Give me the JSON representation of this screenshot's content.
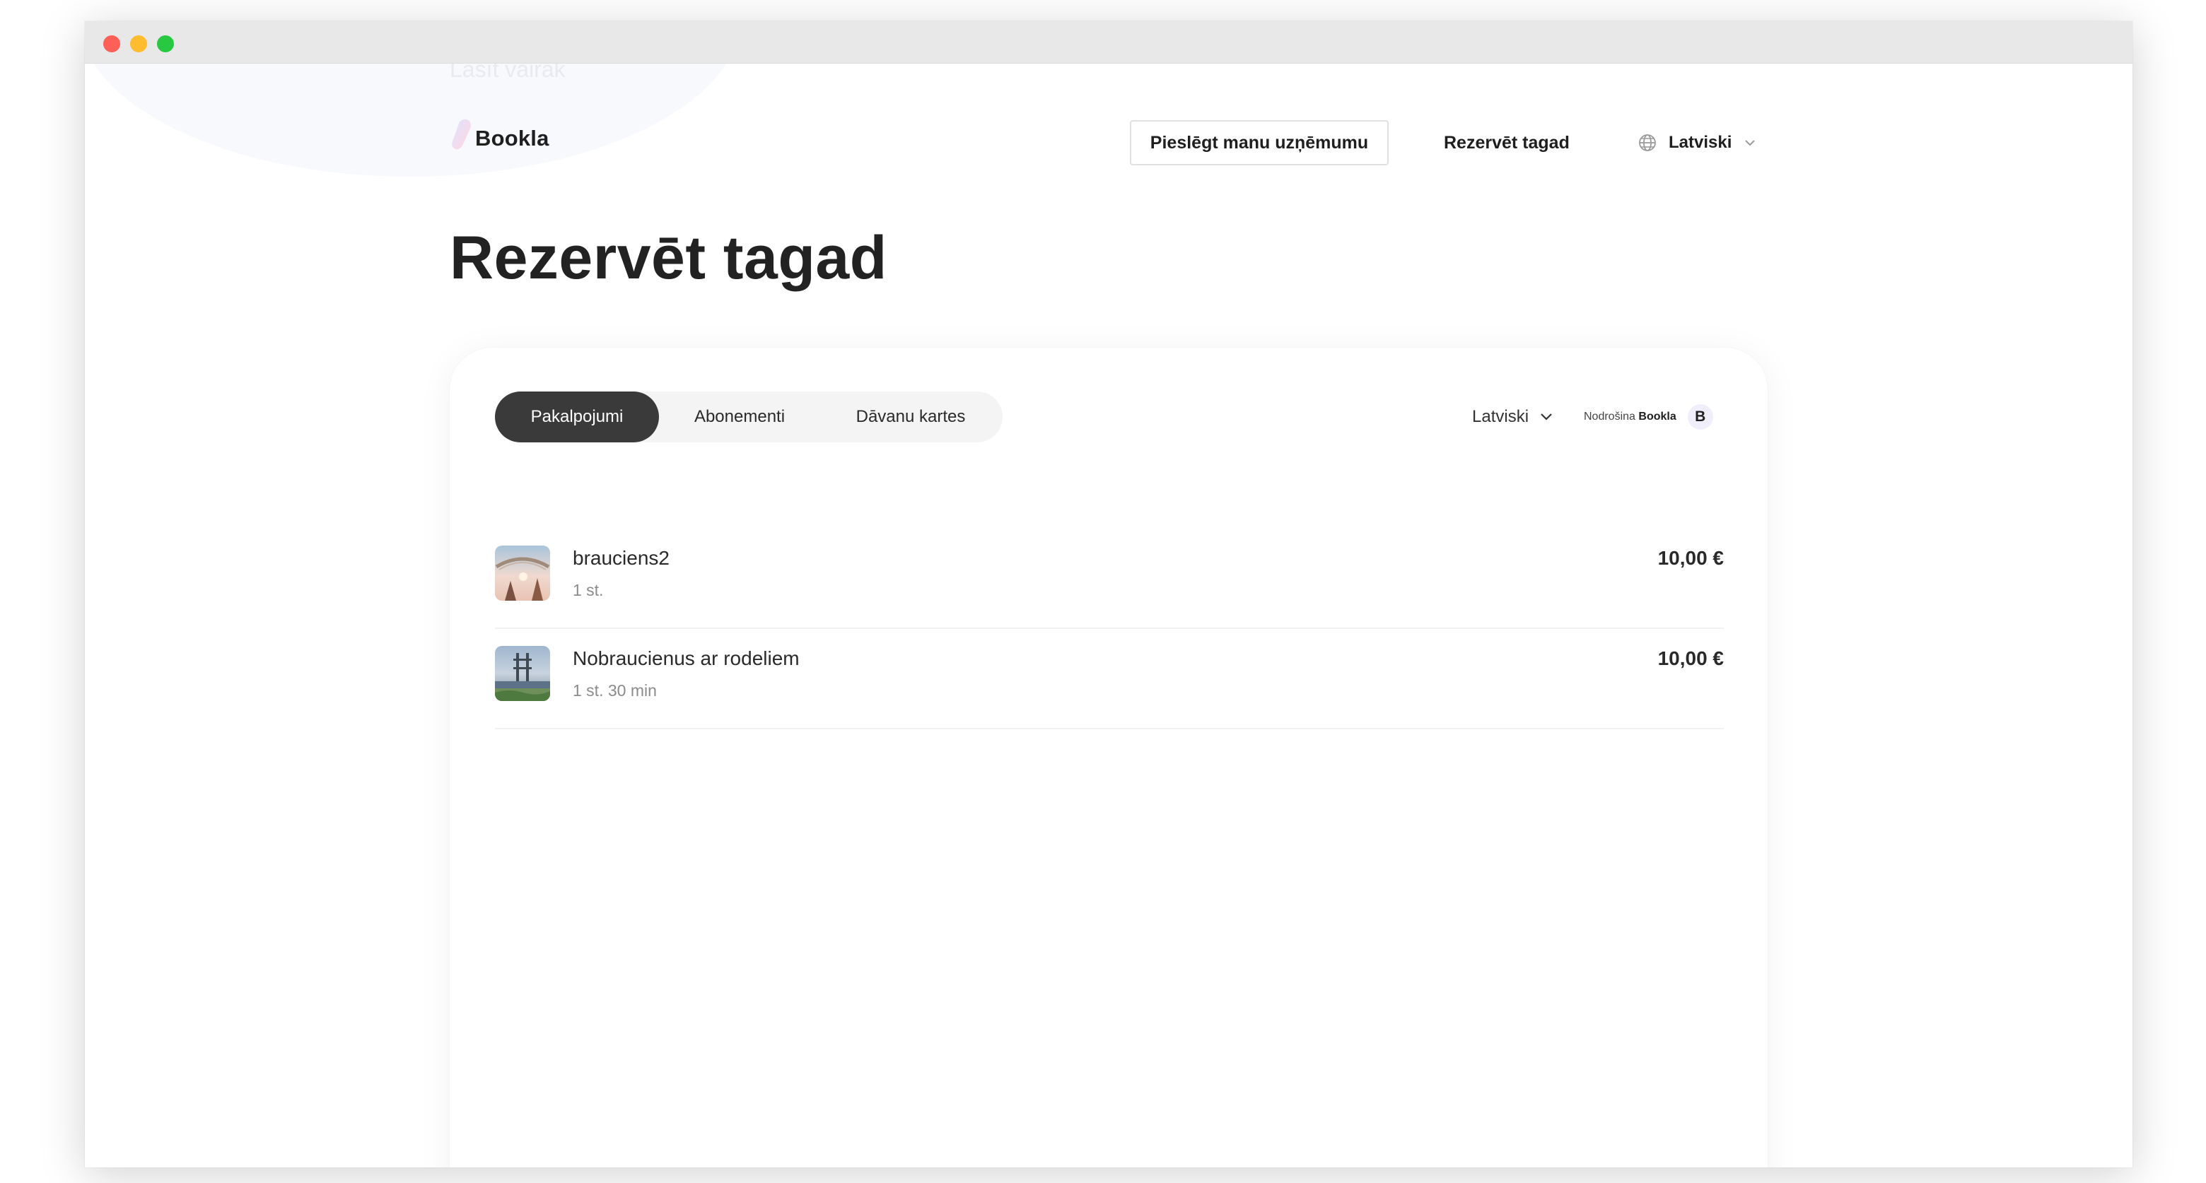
{
  "window": {
    "controls": [
      "close",
      "minimize",
      "zoom"
    ]
  },
  "background": {
    "ghost_text": "Lasīt vairāk"
  },
  "header": {
    "logo_text": "Bookla",
    "connect_button": "Pieslēgt manu uzņēmumu",
    "reserve_link": "Rezervēt tagad",
    "language": "Latviski",
    "icons": {
      "language": "globe-icon",
      "dropdown": "chevron-down-icon"
    }
  },
  "page": {
    "title": "Rezervēt tagad"
  },
  "widget": {
    "tabs": [
      {
        "label": "Pakalpojumi",
        "active": true
      },
      {
        "label": "Abonementi",
        "active": false
      },
      {
        "label": "Dāvanu kartes",
        "active": false
      }
    ],
    "language": "Latviski",
    "powered_by_label": "Nodrošina",
    "powered_by_brand": "Bookla",
    "powered_badge": "B",
    "services": [
      {
        "name": "brauciens2",
        "duration": "1 st.",
        "price": "10,00 €"
      },
      {
        "name": "Nobraucienus ar rodeliem",
        "duration": "1 st. 30 min",
        "price": "10,00 €"
      }
    ]
  },
  "colors": {
    "accent_dark": "#3a3a3a",
    "text_primary": "#222222",
    "text_muted": "#8b8b8b",
    "tabs_bg": "#f4f4f4"
  }
}
